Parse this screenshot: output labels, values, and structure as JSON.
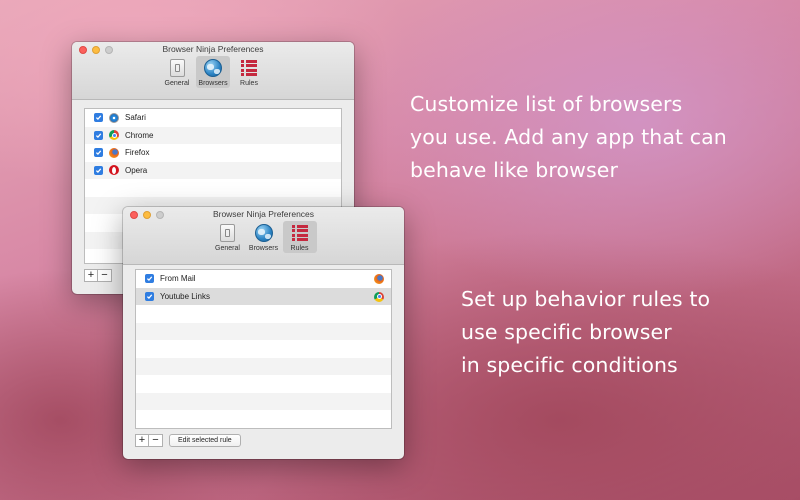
{
  "promo": {
    "line1": "Customize list of browsers",
    "line2": "you use. Add any app that can",
    "line3": "behave like browser",
    "line4": "Set up behavior rules to",
    "line5": "use specific browser",
    "line6": "in specific conditions"
  },
  "window_browsers": {
    "title": "Browser Ninja Preferences",
    "tabs": [
      {
        "label": "General",
        "icon": "general-switch-icon"
      },
      {
        "label": "Browsers",
        "icon": "globe-icon",
        "active": true
      },
      {
        "label": "Rules",
        "icon": "rules-list-icon"
      }
    ],
    "browsers": [
      {
        "name": "Safari",
        "checked": true,
        "icon": "safari-icon"
      },
      {
        "name": "Chrome",
        "checked": true,
        "icon": "chrome-icon"
      },
      {
        "name": "Firefox",
        "checked": true,
        "icon": "firefox-icon"
      },
      {
        "name": "Opera",
        "checked": true,
        "icon": "opera-icon"
      }
    ],
    "add_label": "+",
    "remove_label": "−"
  },
  "window_rules": {
    "title": "Browser Ninja Preferences",
    "tabs": [
      {
        "label": "General",
        "icon": "general-switch-icon"
      },
      {
        "label": "Browsers",
        "icon": "globe-icon"
      },
      {
        "label": "Rules",
        "icon": "rules-list-icon",
        "active": true
      }
    ],
    "rules": [
      {
        "name": "From Mail",
        "checked": true,
        "browser_icon": "firefox-icon"
      },
      {
        "name": "Youtube Links",
        "checked": true,
        "browser_icon": "chrome-icon",
        "selected": true
      }
    ],
    "add_label": "+",
    "remove_label": "−",
    "edit_label": "Edit selected rule"
  },
  "colors": {
    "accent": "#2f7de1",
    "rules_icon": "#c5293f"
  }
}
